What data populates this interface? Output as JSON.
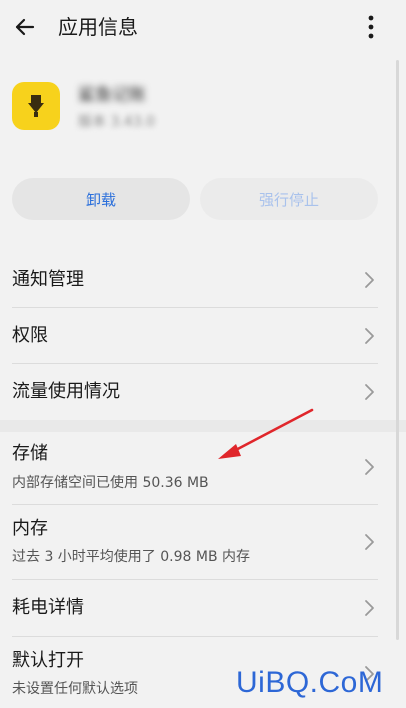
{
  "header": {
    "title": "应用信息",
    "back_icon": "arrow-left-icon",
    "more_icon": "more-vertical-icon"
  },
  "app": {
    "name": "鲨鱼记账",
    "version": "版本 3.43.0",
    "icon_color": "#f7d21c"
  },
  "actions": {
    "uninstall_label": "卸载",
    "force_stop_label": "强行停止"
  },
  "rows": [
    {
      "label": "通知管理"
    },
    {
      "label": "权限"
    },
    {
      "label": "流量使用情况"
    },
    {
      "label": "存储",
      "sub": "内部存储空间已使用 50.36 MB"
    },
    {
      "label": "内存",
      "sub": "过去 3 小时平均使用了 0.98 MB 内存"
    },
    {
      "label": "耗电详情"
    },
    {
      "label": "默认打开",
      "sub": "未设置任何默认选项"
    }
  ],
  "watermark": "UiBQ.CoM",
  "colors": {
    "accent": "#2a6fdb",
    "annotation": "#e0262b"
  }
}
